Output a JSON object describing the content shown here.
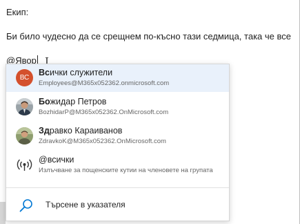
{
  "editor": {
    "greeting": "Екип:",
    "body_text": "Би било чудесно да се срещнем по-късно тази седмица, така че все",
    "mention_text": "@Явор"
  },
  "suggestions": [
    {
      "initials": "ВС",
      "name_bold": "Вс",
      "name_rest": "ички служители",
      "email": "Employees@M365x052362.onmicrosoft.com",
      "avatar": "initials",
      "avatar_color": "#d4502d"
    },
    {
      "name_bold": "Бо",
      "name_rest": "жидар Петров",
      "email": "BozhidarP@M365x052362.OnMicrosoft.com",
      "avatar": "photo-icon"
    },
    {
      "name_bold": "Зд",
      "name_rest": "равко Караиванов",
      "email": "ZdravkoK@M365x052362.OnMicrosoft.com",
      "avatar": "photo-icon"
    },
    {
      "name_bold": "",
      "name_rest": "@всички",
      "email": "Излъчване за пощенските кутии на членовете на групата",
      "avatar": "broadcast-icon"
    }
  ],
  "search_directory": {
    "label": "Търсене в указателя",
    "icon": "search-icon"
  },
  "colors": {
    "selected_bg": "#e9f1fb",
    "accent": "#0078d4"
  }
}
